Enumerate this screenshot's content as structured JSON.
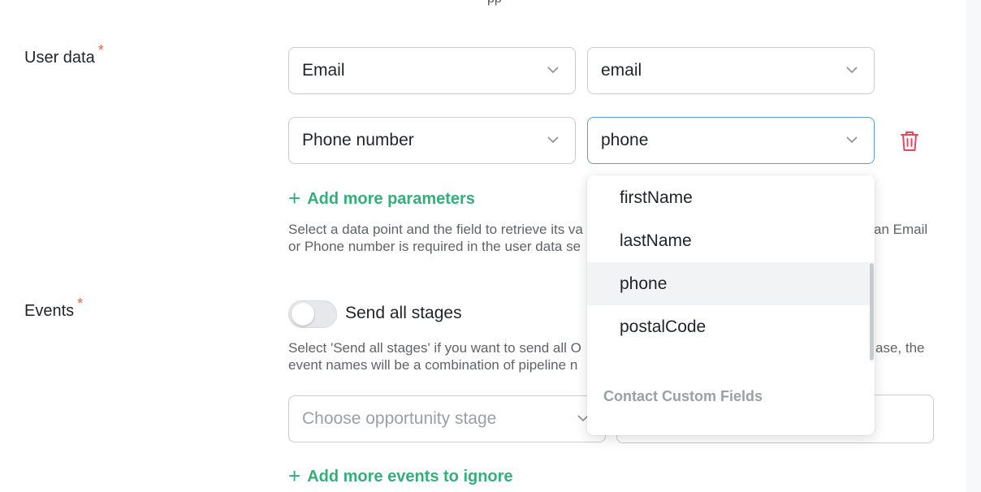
{
  "top_fragment": "pp",
  "user_data": {
    "label": "User data",
    "required_mark": "*",
    "rows": [
      {
        "data_point": "Email",
        "field": "email"
      },
      {
        "data_point": "Phone number",
        "field": "phone"
      }
    ],
    "add_label": "Add more parameters",
    "help_line1_a": "Select a data point and the field to retrieve its va",
    "help_line1_b": "an Email",
    "help_line2": "or Phone number is required in the user data se"
  },
  "field_dropdown": {
    "options": [
      "firstName",
      "lastName",
      "phone",
      "postalCode"
    ],
    "hovered": "phone",
    "group_label": "Contact Custom Fields"
  },
  "events": {
    "label": "Events",
    "required_mark": "*",
    "toggle_label": "Send all stages",
    "toggle_on": false,
    "help_line1_a": "Select 'Send all stages' if you want to send all O",
    "help_line1_b": "ase, the",
    "help_line2": "event names will be a combination of pipeline n",
    "stage_placeholder": "Choose opportunity stage",
    "add_label": "Add more events to ignore"
  },
  "colors": {
    "accent_green": "#33b07a",
    "required_orange": "#e8623a",
    "delete_red": "#e8475f",
    "focus_border": "#5a9fd6"
  },
  "icons": [
    "chevron-down-icon",
    "trash-icon",
    "plus-icon"
  ]
}
